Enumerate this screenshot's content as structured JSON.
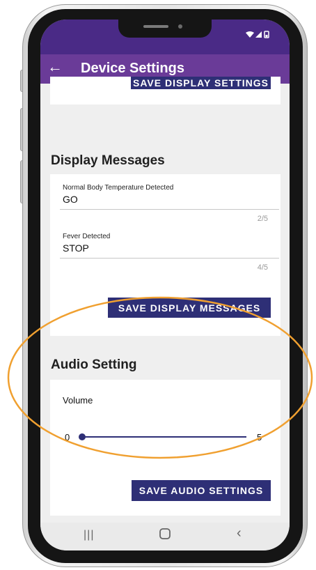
{
  "app": {
    "title": "Device Settings"
  },
  "top_card": {
    "button_label": "SAVE DISPLAY SETTINGS"
  },
  "display_messages": {
    "title": "Display Messages",
    "fields": [
      {
        "label": "Normal Body Temperature Detected",
        "value": "GO",
        "counter": "2/5"
      },
      {
        "label": "Fever Detected",
        "value": "STOP",
        "counter": "4/5"
      }
    ],
    "save_label": "SAVE DISPLAY MESSAGES"
  },
  "audio": {
    "title": "Audio Setting",
    "volume_label": "Volume",
    "volume_min": "0",
    "volume_max": "5",
    "volume_value": 0,
    "save_label": "SAVE AUDIO SETTINGS"
  },
  "colors": {
    "status_bar": "#4a2a86",
    "app_bar": "#6a3b98",
    "button": "#2e2f76",
    "highlight": "#f0a030"
  },
  "nav": {
    "recents_icon": "recents-icon",
    "home_icon": "home-icon",
    "back_icon": "back-icon"
  }
}
